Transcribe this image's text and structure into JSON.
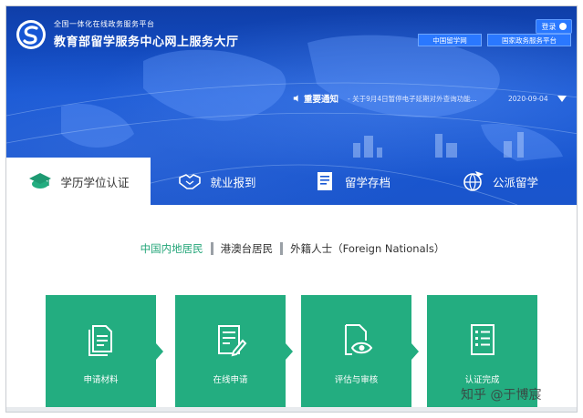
{
  "header": {
    "subtitle": "全国一体化在线政务服务平台",
    "title": "教育部留学服务中心网上服务大厅",
    "login_label": "登录",
    "links": [
      "中国留学网",
      "国家政务服务平台"
    ]
  },
  "notice": {
    "label": "重要通知",
    "text": "- 关于9月4日暂停电子延期对外查询功能...",
    "date": "2020-09-04"
  },
  "tabs": [
    {
      "label": "学历学位认证",
      "active": true,
      "icon": "graduation-cap-icon"
    },
    {
      "label": "就业报到",
      "active": false,
      "icon": "handshake-icon"
    },
    {
      "label": "留学存档",
      "active": false,
      "icon": "archive-folder-icon"
    },
    {
      "label": "公派留学",
      "active": false,
      "icon": "globe-plane-icon"
    }
  ],
  "residency": {
    "options": [
      "中国内地居民",
      "港澳台居民",
      "外籍人士（Foreign Nationals）"
    ],
    "selected": "中国内地居民"
  },
  "steps": [
    {
      "label": "申请材料",
      "icon": "documents-icon"
    },
    {
      "label": "在线申请",
      "icon": "form-edit-icon"
    },
    {
      "label": "评估与审核",
      "icon": "document-eye-icon"
    },
    {
      "label": "认证完成",
      "icon": "checklist-icon"
    }
  ],
  "watermark": "知乎 @于博宸",
  "colors": {
    "header_blue": "#1656d4",
    "accent_green": "#23ad80",
    "selected_text": "#23a578"
  }
}
